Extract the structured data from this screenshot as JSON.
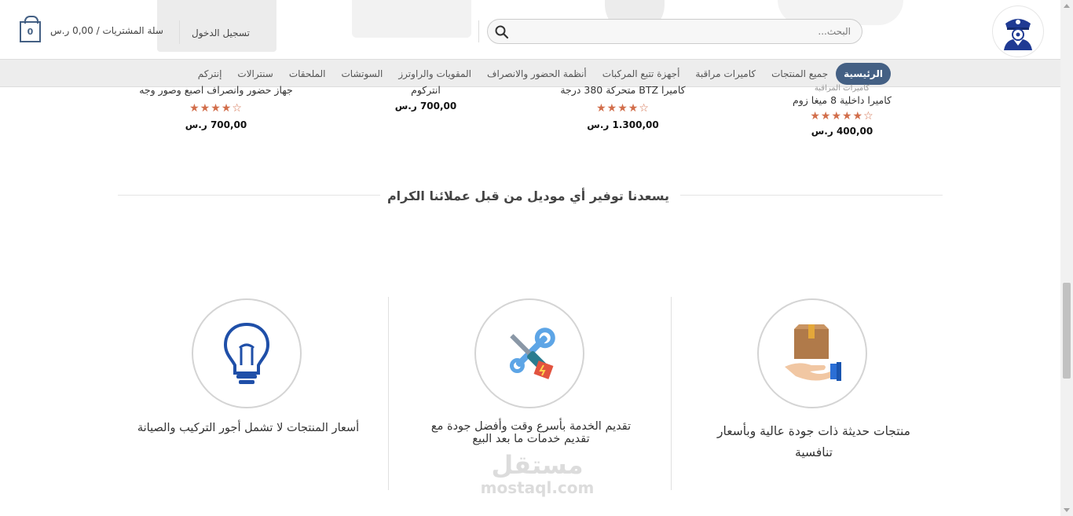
{
  "header": {
    "search_placeholder": "البحث...",
    "login_label": "تسجيل الدخول",
    "cart_label": "سلة المشتريات / 0,00 ر.س",
    "cart_count": "0",
    "logo_icon": "police-officer-logo-icon",
    "search_icon": "search-icon"
  },
  "nav": {
    "items": [
      {
        "label": "الرئيسية"
      },
      {
        "label": "جميع المنتجات"
      },
      {
        "label": "كاميرات مراقبة"
      },
      {
        "label": "أجهزة تتبع المركبات"
      },
      {
        "label": "أنظمة الحضور والانصراف"
      },
      {
        "label": "المقويات والراوترز"
      },
      {
        "label": "السوتشات"
      },
      {
        "label": "الملحقات"
      },
      {
        "label": "سنترالات"
      },
      {
        "label": "إنتركم"
      }
    ],
    "accent_color": "#446084"
  },
  "products": [
    {
      "category": "كاميرات المراقبة",
      "name": "كاميرا داخلية 8 ميغا زوم",
      "stars": "★★★★★☆",
      "price": "400,00 ر.س"
    },
    {
      "category": "",
      "name": "كاميرا BTZ متحركة 380 درجة",
      "stars": "★★★★☆",
      "price": "1.300,00 ر.س"
    },
    {
      "category": "",
      "name": "انتركوم",
      "stars": "",
      "price": "700,00 ر.س"
    },
    {
      "category": "",
      "name": "جهاز حضور وانصراف اصبع وصور وجه",
      "stars": "★★★★☆",
      "price": "700,00 ر.س"
    }
  ],
  "section": {
    "title": "يسعدنا توفير أي موديل من قبل عملائنا الكرام"
  },
  "features": [
    {
      "icon": "package-in-hand-icon",
      "text": "منتجات حديثة ذات جودة عالية وبأسعار تنافسية"
    },
    {
      "icon": "tools-wrench-screwdriver-icon",
      "text": "تقديم الخدمة بأسرع وقت وأفضل جودة مع تقديم خدمات ما بعد البيع"
    },
    {
      "icon": "light-bulb-icon",
      "text": "أسعار المنتجات لا تشمل أجور التركيب والصيانة"
    }
  ],
  "watermark": {
    "line1": "مستقل",
    "line2": "mostaql.com"
  }
}
